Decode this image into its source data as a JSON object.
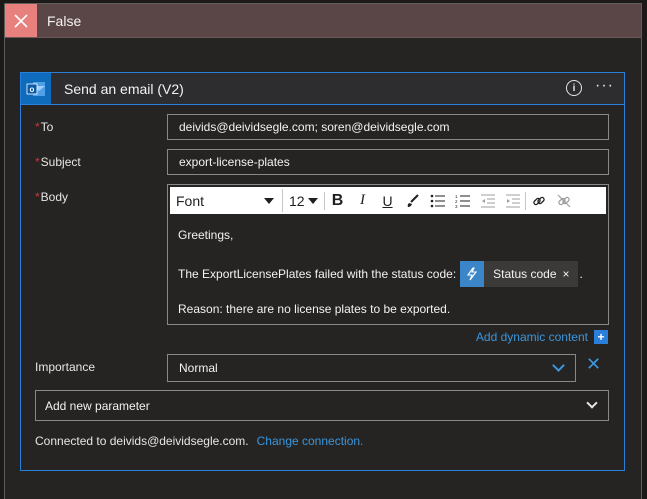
{
  "branch": {
    "title": "False"
  },
  "action": {
    "title": "Send an email (V2)",
    "fields": {
      "to_label": "To",
      "to_value": "deivids@deividsegle.com; soren@deividsegle.com",
      "subject_label": "Subject",
      "subject_value": "export-license-plates",
      "body_label": "Body"
    },
    "toolbar": {
      "font": "Font",
      "size": "12",
      "bold": "B",
      "italic": "I",
      "underline": "U"
    },
    "body": {
      "line1": "Greetings,",
      "line2_prefix": "The ExportLicensePlates failed with the status code:",
      "token_label": "Status code",
      "token_close": "×",
      "line2_suffix": ".",
      "line3": "Reason: there are no license plates to be exported."
    },
    "dynamic_content_label": "Add dynamic content",
    "importance": {
      "label": "Importance",
      "value": "Normal"
    },
    "add_param_label": "Add new parameter",
    "connection": {
      "text": "Connected to deivids@deividsegle.com.",
      "change_link": "Change connection."
    }
  },
  "colors": {
    "accent": "#2a7fdb",
    "link": "#3a96dd",
    "required": "#d13438",
    "branch_header": "#5a4646"
  }
}
